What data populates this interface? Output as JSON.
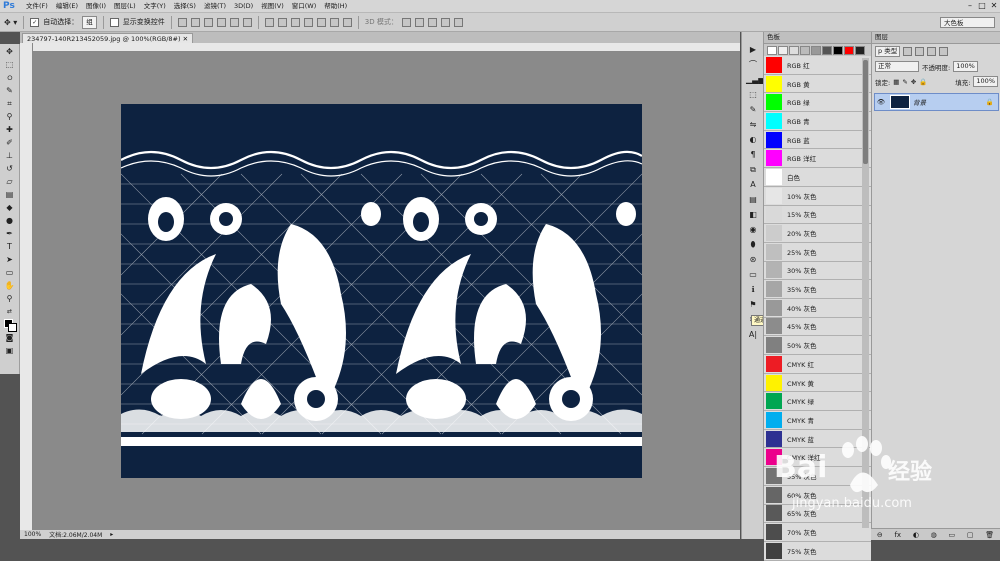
{
  "app": {
    "logo": "Ps"
  },
  "menu": [
    "文件(F)",
    "编辑(E)",
    "图像(I)",
    "图层(L)",
    "文字(Y)",
    "选择(S)",
    "滤镜(T)",
    "3D(D)",
    "视图(V)",
    "窗口(W)",
    "帮助(H)"
  ],
  "window_buttons": [
    "–",
    "□",
    "✕"
  ],
  "options": {
    "auto_select_label": "自动选择：",
    "auto_select_value": "组",
    "show_transform_label": "显示变换控件",
    "mode_3d_label": "3D 模式：",
    "workspace": "大色板"
  },
  "document": {
    "tab_title": "234797-140R213452059.jpg @ 100%(RGB/8#)",
    "zoom": "100%",
    "doc_info": "文档:2.06M/2.04M"
  },
  "tooltip": "通道",
  "swatches": {
    "title": "色板",
    "recent": [
      "#ffffff",
      "#eeeeee",
      "#dddddd",
      "#bbbbbb",
      "#999999",
      "#555555",
      "#000000",
      "#ff0000",
      "#222222"
    ],
    "items": [
      {
        "label": "RGB 红",
        "color": "#ff0000"
      },
      {
        "label": "RGB 黄",
        "color": "#ffff00"
      },
      {
        "label": "RGB 绿",
        "color": "#00ff00"
      },
      {
        "label": "RGB 青",
        "color": "#00ffff"
      },
      {
        "label": "RGB 蓝",
        "color": "#0000ff"
      },
      {
        "label": "RGB 洋红",
        "color": "#ff00ff"
      },
      {
        "label": "白色",
        "color": "#ffffff"
      },
      {
        "label": "10% 灰色",
        "color": "#e6e6e6"
      },
      {
        "label": "15% 灰色",
        "color": "#d9d9d9"
      },
      {
        "label": "20% 灰色",
        "color": "#cccccc"
      },
      {
        "label": "25% 灰色",
        "color": "#bfbfbf"
      },
      {
        "label": "30% 灰色",
        "color": "#b3b3b3"
      },
      {
        "label": "35% 灰色",
        "color": "#a6a6a6"
      },
      {
        "label": "40% 灰色",
        "color": "#999999"
      },
      {
        "label": "45% 灰色",
        "color": "#8c8c8c"
      },
      {
        "label": "50% 灰色",
        "color": "#808080"
      },
      {
        "label": "CMYK 红",
        "color": "#ed1c24"
      },
      {
        "label": "CMYK 黄",
        "color": "#fff200"
      },
      {
        "label": "CMYK 绿",
        "color": "#00a651"
      },
      {
        "label": "CMYK 青",
        "color": "#00aeef"
      },
      {
        "label": "CMYK 蓝",
        "color": "#2e3192"
      },
      {
        "label": "CMYK 洋红",
        "color": "#ec008c"
      },
      {
        "label": "55% 灰色",
        "color": "#737373"
      },
      {
        "label": "60% 灰色",
        "color": "#666666"
      },
      {
        "label": "65% 灰色",
        "color": "#595959"
      },
      {
        "label": "70% 灰色",
        "color": "#4d4d4d"
      },
      {
        "label": "75% 灰色",
        "color": "#404040"
      }
    ]
  },
  "layers": {
    "title": "图层",
    "kind": "p 类型",
    "blend_mode": "正常",
    "opacity_label": "不透明度:",
    "opacity_value": "100%",
    "lock_label": "锁定:",
    "fill_label": "填充:",
    "fill_value": "100%",
    "layer_name": "背景",
    "bottom_icons": [
      "⊖",
      "fx",
      "◐",
      "◍",
      "▭",
      "▢",
      "🗑"
    ]
  },
  "watermark": {
    "brand": "Bai",
    "brand2": "经验",
    "url": "jingyan.baidu.com",
    "color": "#ffffff"
  },
  "colors": {
    "image_bg": "#0d2240",
    "lace": "#ffffff",
    "selected_layer": "#b7cef0"
  }
}
